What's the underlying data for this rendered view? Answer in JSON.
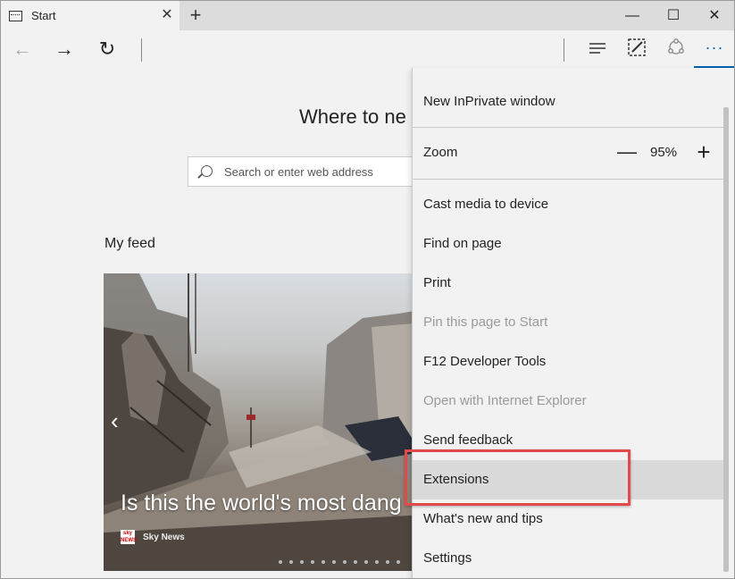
{
  "tab": {
    "title": "Start",
    "close": "✕",
    "new_tab": "+"
  },
  "window_controls": {
    "minimize": "—",
    "maximize": "☐",
    "close": "✕"
  },
  "toolbar": {
    "back": "←",
    "forward": "→",
    "refresh": "↻",
    "more": "···"
  },
  "page": {
    "heading": "Where to ne",
    "search_placeholder": "Search or enter web address",
    "feed_title": "My feed",
    "card": {
      "headline": "Is this the world's most dang",
      "source": "Sky News",
      "source_logo": "sky NEWS"
    }
  },
  "menu": {
    "items_top": [
      {
        "label": "New InPrivate window"
      }
    ],
    "zoom": {
      "label": "Zoom",
      "minus": "—",
      "value": "95%",
      "plus": "+"
    },
    "items": [
      {
        "label": "Cast media to device",
        "disabled": false
      },
      {
        "label": "Find on page",
        "disabled": false
      },
      {
        "label": "Print",
        "disabled": false
      },
      {
        "label": "Pin this page to Start",
        "disabled": true
      },
      {
        "label": "F12 Developer Tools",
        "disabled": false
      },
      {
        "label": "Open with Internet Explorer",
        "disabled": true
      },
      {
        "label": "Send feedback",
        "disabled": false
      },
      {
        "label": "Extensions",
        "disabled": false,
        "highlighted": true
      },
      {
        "label": "What's new and tips",
        "disabled": false
      },
      {
        "label": "Settings",
        "disabled": false
      }
    ]
  },
  "colors": {
    "accent": "#0063b1",
    "highlight_box": "#e04a4a",
    "menu_bg": "#f2f2f2"
  }
}
